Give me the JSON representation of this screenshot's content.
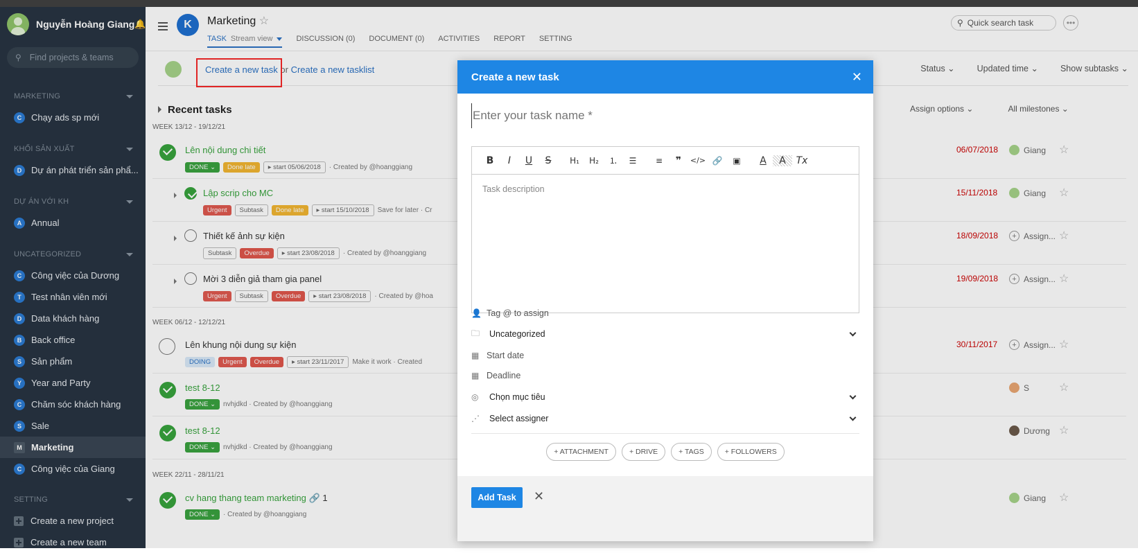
{
  "sidebar": {
    "user_name": "Nguyễn Hoàng Giang",
    "search_placeholder": "Find projects & teams",
    "sections": [
      {
        "title": "MARKETING",
        "items": [
          {
            "badge": "C",
            "label": "Chạy ads sp mới"
          }
        ]
      },
      {
        "title": "KHỐI SẢN XUẤT",
        "items": [
          {
            "badge": "D",
            "label": "Dự án phát triển sản phẩ..."
          }
        ]
      },
      {
        "title": "DỰ ÁN VỚI KH",
        "items": [
          {
            "badge": "A",
            "label": "Annual"
          }
        ]
      },
      {
        "title": "UNCATEGORIZED",
        "items": [
          {
            "badge": "C",
            "label": "Công việc của Dương"
          },
          {
            "badge": "T",
            "label": "Test nhân viên mới"
          },
          {
            "badge": "D",
            "label": "Data khách hàng"
          },
          {
            "badge": "B",
            "label": "Back office"
          },
          {
            "badge": "S",
            "label": "Sản phẩm"
          },
          {
            "badge": "Y",
            "label": "Year and Party"
          },
          {
            "badge": "C",
            "label": "Chăm sóc khách hàng"
          },
          {
            "badge": "S",
            "label": "Sale"
          },
          {
            "badge": "M",
            "label": "Marketing"
          },
          {
            "badge": "C",
            "label": "Công việc của Giang"
          }
        ]
      },
      {
        "title": "SETTING",
        "items": [
          {
            "label": "Create a new project"
          },
          {
            "label": "Create a new team"
          }
        ]
      }
    ]
  },
  "header": {
    "project_title": "Marketing",
    "logo": "K",
    "tabs": [
      "TASK",
      "DISCUSSION (0)",
      "DOCUMENT (0)",
      "ACTIVITIES",
      "REPORT",
      "SETTING"
    ],
    "view_mode": "Stream view",
    "quick_search_placeholder": "Quick search task"
  },
  "toolbar": {
    "create_task": "Create a new task",
    "or": "or",
    "create_tasklist": "Create a new tasklist",
    "filters": [
      "Status",
      "Updated time",
      "Show subtasks"
    ]
  },
  "list": {
    "recent_title": "Recent tasks",
    "assign_options": "Assign options",
    "all_milestones": "All milestones",
    "week1": "WEEK 13/12 - 19/12/21",
    "week2": "WEEK 06/12 - 12/12/21",
    "week3": "WEEK 22/11 - 28/11/21",
    "tasks": [
      {
        "title": "Lên nội dung chi tiết",
        "tags": [
          "DONE ⌄",
          "Done late",
          "▸ start 05/06/2018"
        ],
        "meta": "· Created by @hoanggiang",
        "date": "06/07/2018",
        "assignee": "Giang"
      },
      {
        "title": "Lập scrip cho MC",
        "tags": [
          "Urgent",
          "Subtask",
          "Done late",
          "▸ start 15/10/2018"
        ],
        "meta": "Save for later · Cr",
        "date": "15/11/2018",
        "assignee": "Giang"
      },
      {
        "title": "Thiết kế ảnh sự kiện",
        "tags": [
          "Subtask",
          "Overdue",
          "▸ start 23/08/2018"
        ],
        "meta": "· Created by @hoanggiang",
        "date": "18/09/2018",
        "assignee": "Assign..."
      },
      {
        "title": "Mời 3 diễn giả tham gia panel",
        "tags": [
          "Urgent",
          "Subtask",
          "Overdue",
          "▸ start 23/08/2018"
        ],
        "meta": "· Created by @hoa",
        "date": "19/09/2018",
        "assignee": "Assign..."
      },
      {
        "title": "Lên khung nội dung sự kiện",
        "tags": [
          "DOING",
          "Urgent",
          "Overdue",
          "▸ start 23/11/2017"
        ],
        "meta": "Make it work · Created",
        "date": "30/11/2017",
        "assignee": "Assign..."
      },
      {
        "title": "test 8-12",
        "tags": [
          "DONE ⌄"
        ],
        "meta": "nvhjdkd · Created by @hoanggiang",
        "date": "",
        "assignee": "S"
      },
      {
        "title": "test 8-12",
        "tags": [
          "DONE ⌄"
        ],
        "meta": "nvhjdkd · Created by @hoanggiang",
        "date": "",
        "assignee": "Dương"
      },
      {
        "title": "cv hang thang team marketing",
        "tags": [
          "DONE ⌄"
        ],
        "meta": "· Created by @hoanggiang",
        "date": "",
        "assignee": "Giang",
        "attach_count": "1"
      }
    ]
  },
  "modal": {
    "title": "Create a new task",
    "task_name_placeholder": "Enter your task name *",
    "description_placeholder": "Task description",
    "editor_buttons": [
      "B",
      "I",
      "U",
      "S",
      "H1",
      "H2",
      "ol",
      "ul",
      "align",
      "quote",
      "code",
      "link",
      "image",
      "A",
      "bg",
      "Tx"
    ],
    "fields": {
      "tag": "Tag @ to assign",
      "folder": "Uncategorized",
      "start": "Start date",
      "deadline": "Deadline",
      "goal": "Chọn mục tiêu",
      "assigner": "Select assigner"
    },
    "pills": [
      "+ ATTACHMENT",
      "+ DRIVE",
      "+ TAGS",
      "+ FOLLOWERS"
    ],
    "add_button": "Add Task"
  }
}
